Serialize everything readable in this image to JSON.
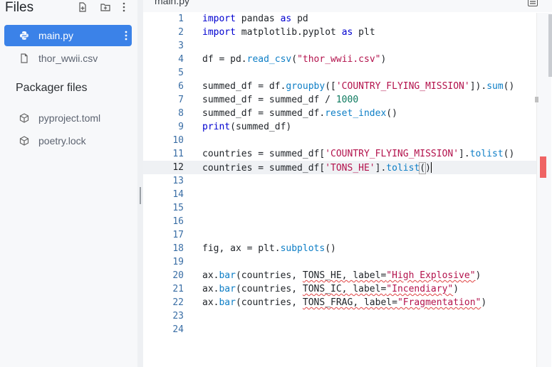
{
  "sidebar": {
    "title": "Files",
    "files": [
      {
        "name": "main.py",
        "icon": "python-file-icon",
        "active": true
      },
      {
        "name": "thor_wwii.csv",
        "icon": "file-icon",
        "active": false
      }
    ],
    "packager_title": "Packager files",
    "packager_files": [
      {
        "name": "pyproject.toml",
        "icon": "package-icon"
      },
      {
        "name": "poetry.lock",
        "icon": "package-icon"
      }
    ]
  },
  "editor": {
    "tab": "main.py",
    "current_line": 12,
    "lines": [
      {
        "n": "1",
        "html": "<span class=\"kw\">import</span> pandas <span class=\"kw\">as</span> pd"
      },
      {
        "n": "2",
        "html": "<span class=\"kw\">import</span> matplotlib.pyplot <span class=\"kw\">as</span> plt"
      },
      {
        "n": "3",
        "html": ""
      },
      {
        "n": "4",
        "html": "df = pd.<span class=\"fn\">read_csv</span>(<span class=\"str\">\"thor_wwii.csv\"</span>)"
      },
      {
        "n": "5",
        "html": ""
      },
      {
        "n": "6",
        "html": "summed_df = df.<span class=\"fn\">groupby</span>([<span class=\"str\">'COUNTRY_FLYING_MISSION'</span>]).<span class=\"fn\">sum</span>()"
      },
      {
        "n": "7",
        "html": "summed_df = summed_df / <span class=\"num\">1000</span>"
      },
      {
        "n": "8",
        "html": "summed_df = summed_df.<span class=\"fn\">reset_index</span>()"
      },
      {
        "n": "9",
        "html": "<span class=\"kw\">print</span>(summed_df)"
      },
      {
        "n": "10",
        "html": ""
      },
      {
        "n": "11",
        "html": "countries = summed_df[<span class=\"str\">'COUNTRY_FLYING_MISSION'</span>].<span class=\"fn\">tolist</span>()"
      },
      {
        "n": "12",
        "html": "countries = summed_df[<span class=\"str\">'TONS_HE'</span>].<span class=\"fn\">tolist</span><span class=\"bracket\">(</span>)<span class=\"cursor\"></span>"
      },
      {
        "n": "13",
        "html": ""
      },
      {
        "n": "14",
        "html": ""
      },
      {
        "n": "15",
        "html": ""
      },
      {
        "n": "16",
        "html": ""
      },
      {
        "n": "17",
        "html": ""
      },
      {
        "n": "18",
        "html": "fig, ax = plt.<span class=\"fn\">subplots</span>()"
      },
      {
        "n": "19",
        "html": ""
      },
      {
        "n": "20",
        "html": "ax.<span class=\"fn\">bar</span>(countries, <span class=\"sq\">TONS_HE, label=<span class=\"str\">\"High Explosive\"</span></span>)"
      },
      {
        "n": "21",
        "html": "ax.<span class=\"fn\">bar</span>(countries, <span class=\"sq\">TONS_IC, label=<span class=\"str\">\"Incendiary\"</span></span>)"
      },
      {
        "n": "22",
        "html": "ax.<span class=\"fn\">bar</span>(countries, <span class=\"sq\">TONS_FRAG, label=<span class=\"str\">\"Fragmentation\"</span></span>)"
      },
      {
        "n": "23",
        "html": ""
      },
      {
        "n": "24",
        "html": ""
      }
    ]
  },
  "colors": {
    "accent": "#3b82e8",
    "error_marker": "#ef6464",
    "keyword": "#0000d0",
    "function": "#0d7ec6",
    "string": "#b3124c",
    "number": "#0d7a5f"
  }
}
